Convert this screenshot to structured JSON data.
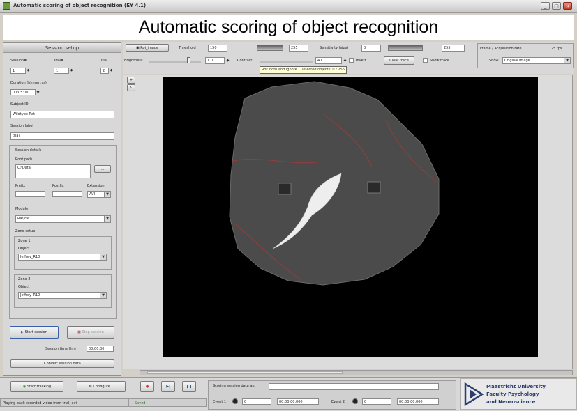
{
  "window": {
    "title": "Automatic scoring of object recognition (EY 4.1)"
  },
  "header": {
    "title": "Automatic scoring of object recognition"
  },
  "session_setup": {
    "heading": "Session setup",
    "sessionnr_label": "Session#",
    "sessionnr_value": "1",
    "trialnr_label": "Trial#",
    "trialnr_value": "1",
    "trial_label": "Trial",
    "trial_value": "2",
    "duration_label": "Duration (hh:mm:ss)",
    "duration_value": "00:05:00",
    "subject_id_label": "Subject ID",
    "subject_id_value": "Wildtype Rat",
    "session_label_label": "Session label",
    "session_label_value": "trial",
    "session_details_label": "Session details",
    "root_path_label": "Root path",
    "root_path_value": "C:\\Data",
    "browse_label": "...",
    "prefix_label": "Prefix",
    "postfix_label": "Postfix",
    "extension_label": "Extension",
    "extension_value": "AVI",
    "module_label": "Module",
    "module_value": "Rat/rat",
    "zone_setup_label": "Zone setup",
    "zone1_label": "Zone 1",
    "zone1_object_label": "Object",
    "zone1_object_value": "Jeffrey_R10",
    "zone2_label": "Zone 2",
    "zone2_object_label": "Object",
    "zone2_object_value": "Jeffrey_R10",
    "start_session_label": "Start session",
    "stop_session_label": "Stop session",
    "session_time_label": "Session time (hh)",
    "session_time_value": "00:00:00",
    "convert_label": "Convert session data"
  },
  "toolbar": {
    "roi_image_label": "Roi_image",
    "threshold_label": "Threshold",
    "threshold_value": "150",
    "threshold_max": "255",
    "sensitivity_label": "Sensitivity (size)",
    "sensitivity_value": "0",
    "sensitivity_max": "255",
    "frame_rate_label": "Frame / Acquisition rate",
    "frame_rate_value": "25 fps",
    "brightness_label": "Brightness",
    "brightness_value": "1.0",
    "contrast_label": "Contrast",
    "contrast_value": "40",
    "invert_label": "Invert",
    "clear_trace_label": "Clear trace",
    "show_trace_label": "Show trace",
    "show_label": "Show",
    "show_value": "Original image",
    "tooltip": "Roi: both and ignore | Detected objects: 0 / 256"
  },
  "bottom": {
    "start_tracking_label": "Start tracking",
    "configure_label": "Configure...",
    "scoring_status_label": "Scoring session data as:",
    "event1_label": "Event 1",
    "event1_count": "0",
    "event1_time": "00:00:00.000",
    "event2_label": "Event 2",
    "event2_count": "0",
    "event2_time": "00:00:00.000",
    "status_text": "Playing back recorded video from trial, avi",
    "status_state": "Saved",
    "logo_line1": "Maastricht University",
    "logo_line2": "Faculty Psychology",
    "logo_line3": "and Neuroscience"
  },
  "colors": {
    "background": "#d4d0c8",
    "video_bg": "#000000",
    "arena": "#4d4d4d",
    "arena_edge": "#a03a3a",
    "brand_blue": "#2b3d6e"
  }
}
